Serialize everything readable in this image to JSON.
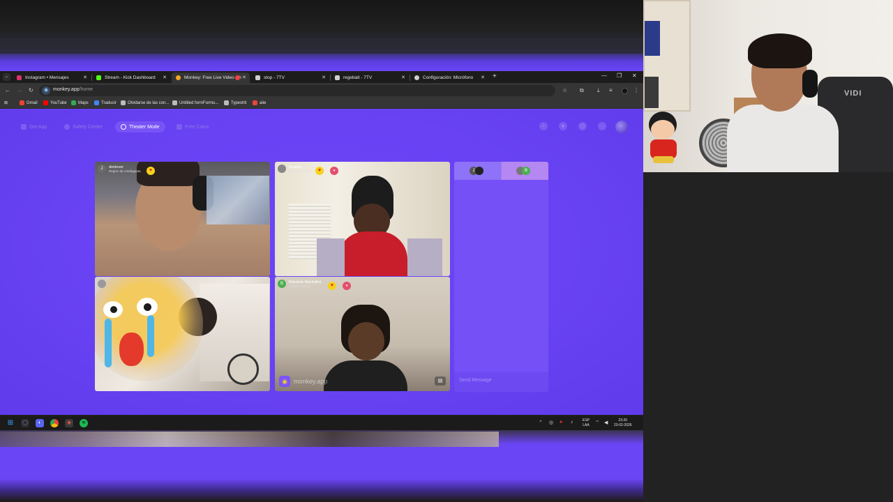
{
  "tabs": [
    {
      "label": "Instagram • Mensajes",
      "color": "#d6336c"
    },
    {
      "label": "Stream - Kick Dashboard",
      "color": "#53fc18"
    },
    {
      "label": "Monkey: Free Live Video Ch",
      "color": "#f5a623"
    },
    {
      "label": "stop - 7TV",
      "color": "#cfcfcf"
    },
    {
      "label": "regebait - 7TV",
      "color": "#cfcfcf"
    },
    {
      "label": "Configuración: Micrófono",
      "color": "#cfcfcf"
    }
  ],
  "address": {
    "domain": "monkey.app",
    "path": "/home"
  },
  "bookmarks": [
    {
      "label": "Gmail",
      "color": "#ea4335"
    },
    {
      "label": "YouTube",
      "color": "#ff0000"
    },
    {
      "label": "Maps",
      "color": "#34a853"
    },
    {
      "label": "Traducir",
      "color": "#4285f4"
    },
    {
      "label": "Olvidarse de las con...",
      "color": "#bbbbbb"
    },
    {
      "label": "Untitled formFormu...",
      "color": "#bbbbbb"
    },
    {
      "label": "Typeshit",
      "color": "#bbbbbb"
    },
    {
      "label": "aiie",
      "color": "#e8453c"
    }
  ],
  "nav": {
    "get_app": "Get App",
    "safety_center": "Safety Center",
    "theater_mode": "Theater Mode",
    "free_coins": "Free Coins"
  },
  "tiles": [
    {
      "initial": "J",
      "name": "donlever",
      "subtitle": "Región de Antofagasta",
      "avatar_color": "#6b6b6b"
    },
    {
      "initial": "",
      "name": "Reaper",
      "subtitle": "Estados Unidos",
      "avatar_color": "#888888"
    },
    {
      "initial": "",
      "name": "",
      "subtitle": "",
      "avatar_color": "#999999"
    },
    {
      "initial": "B",
      "name": "Bsbsbsb Bdmhdhd",
      "subtitle": "Estados Unidos",
      "avatar_color": "#4caf50"
    }
  ],
  "watermark": "monkey.app",
  "chat": {
    "pair_left": [
      "J",
      ""
    ],
    "pair_right": [
      "",
      "B"
    ],
    "send_placeholder": "Send Message"
  },
  "taskbar": {
    "language_line1": "ESP",
    "language_line2": "LAA",
    "time": "23:20",
    "date": "23-02-2026"
  },
  "webcam": {
    "chair_brand": "VIDI"
  }
}
